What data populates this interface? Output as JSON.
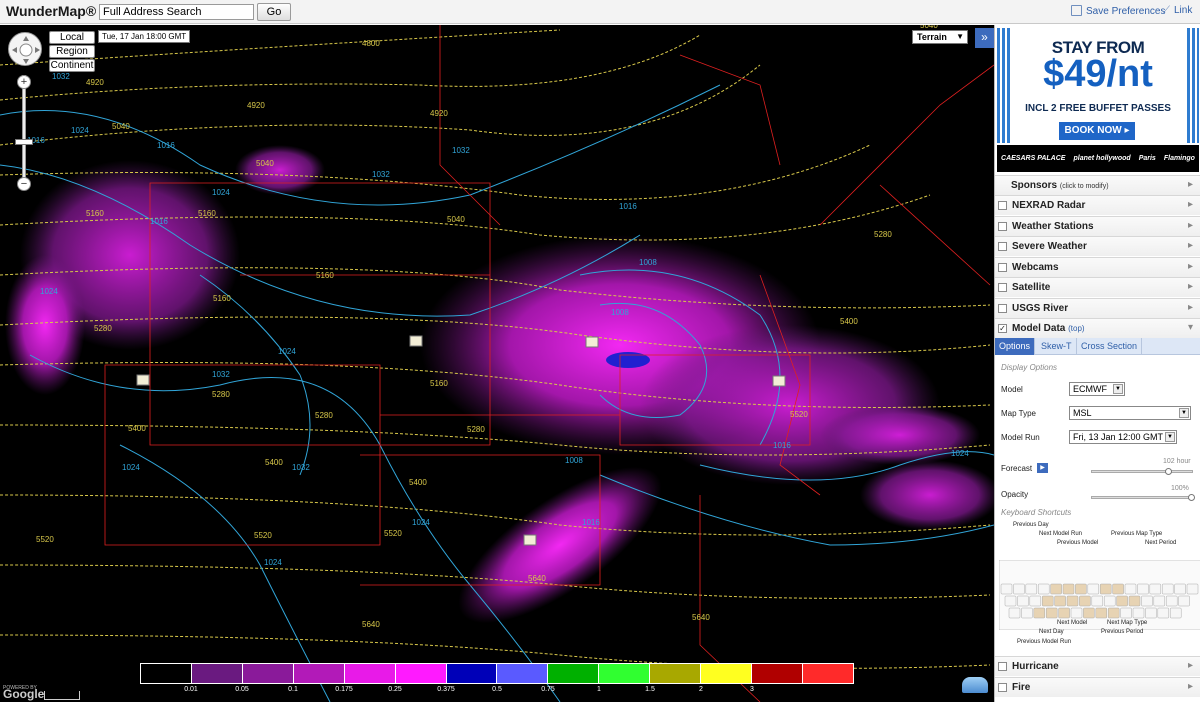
{
  "header": {
    "logo": "WunderMap®",
    "search_placeholder": "Full Address Search",
    "go_label": "Go",
    "save_prefs": "Save Preferences",
    "link": "Link"
  },
  "map": {
    "scale_buttons": [
      "Local",
      "Region",
      "Continent"
    ],
    "timestamp": "Tue, 17 Jan 18:00 GMT",
    "map_type": "Terrain",
    "expand_glyph": "»",
    "zoom_in": "+",
    "zoom_out": "−",
    "powered_by": "POWERED BY",
    "google": "Google",
    "contour_labels": [
      "4800",
      "4920",
      "4920",
      "4920",
      "5040",
      "5040",
      "5040",
      "5160",
      "5160",
      "5160",
      "5160",
      "5160",
      "5280",
      "5280",
      "5280",
      "5280",
      "5280",
      "5400",
      "5400",
      "5400",
      "5400",
      "5520",
      "5520",
      "5520",
      "5520",
      "5640",
      "5640",
      "5640",
      "5040",
      "1032",
      "1032",
      "1032",
      "1024",
      "1024",
      "1024",
      "1016",
      "1016",
      "1016",
      "1016",
      "1008",
      "1008",
      "1024",
      "1032",
      "1024",
      "1032",
      "1016",
      "1008",
      "1024",
      "1024",
      "1016",
      "1024"
    ],
    "legend": {
      "colors": [
        "#000000",
        "#6a1a80",
        "#8a1a9a",
        "#b21ab8",
        "#e81ae8",
        "#ff1aff",
        "#0000b8",
        "#5a5aff",
        "#00b000",
        "#30ff30",
        "#a8a800",
        "#ffff20",
        "#b00000",
        "#ff2a2a"
      ],
      "ticks": [
        "0.01",
        "0.05",
        "0.1",
        "0.175",
        "0.25",
        "0.375",
        "0.5",
        "0.75",
        "1",
        "1.5",
        "2",
        "3"
      ]
    }
  },
  "sidebar": {
    "ad": {
      "headline": "STAY FROM",
      "price": "$49/nt",
      "sub": "INCL 2 FREE BUFFET PASSES",
      "cta": "BOOK NOW ▸",
      "brands": [
        "CAESARS PALACE",
        "planet hollywood",
        "Paris",
        "Flamingo"
      ]
    },
    "layers": {
      "sponsors": "Sponsors",
      "sponsors_note": "(click to modify)",
      "items": [
        "NEXRAD Radar",
        "Weather Stations",
        "Severe Weather",
        "Webcams",
        "Satellite",
        "USGS River"
      ],
      "model_data": "Model Data",
      "model_top": "(top)",
      "bottom": [
        "Hurricane",
        "Fire"
      ]
    },
    "tabs": [
      "Options",
      "Skew-T",
      "Cross Section"
    ],
    "options": {
      "display_heading": "Display Options",
      "model_label": "Model",
      "model_value": "ECMWF",
      "map_type_label": "Map Type",
      "map_type_value": "MSL",
      "model_run_label": "Model Run",
      "model_run_value": "Fri, 13 Jan 12:00 GMT",
      "forecast_label": "Forecast",
      "forecast_value": "102 hour",
      "forecast_progress": 0.75,
      "opacity_label": "Opacity",
      "opacity_value": "100%",
      "opacity_progress": 1.0,
      "shortcuts_heading": "Keyboard Shortcuts",
      "shortcuts": [
        "Previous Day",
        "Next Model Run",
        "Previous Model",
        "Previous Map Type",
        "Next Period",
        "Next Model",
        "Next Map Type",
        "Next Day",
        "Previous Period",
        "Previous Model Run"
      ]
    }
  }
}
